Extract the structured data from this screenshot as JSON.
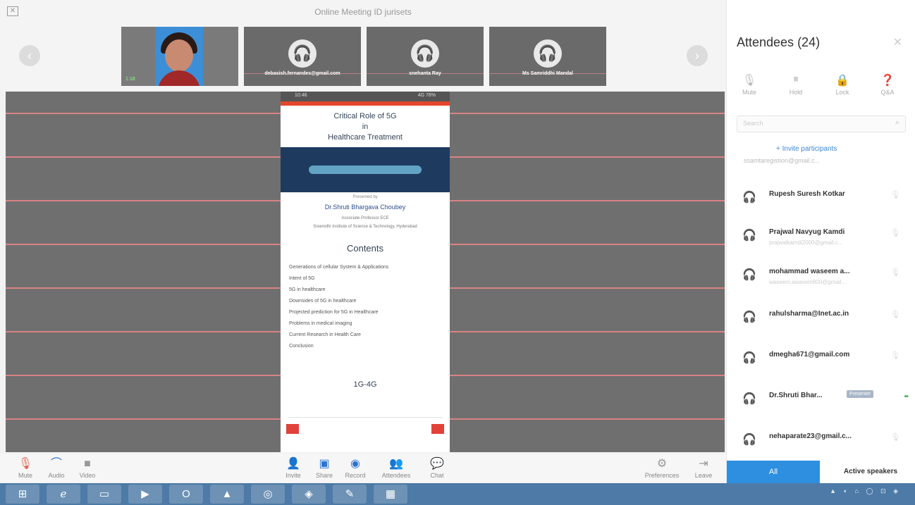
{
  "window": {
    "title": "Online Meeting ID jurisets"
  },
  "video_strip": {
    "tiles": [
      {
        "name": "",
        "badge": "1:18"
      },
      {
        "name": "debasish.fernandes@gmail.com"
      },
      {
        "name": "snehanta Ray"
      },
      {
        "name": "Ms Samriddhi Mandal"
      }
    ]
  },
  "slide": {
    "status_left": "10:46",
    "status_right": "4G 78%",
    "title_line1": "Critical Role of 5G",
    "title_line2": "in",
    "title_line3": "Healthcare Treatment",
    "presented_by": "Presented by",
    "author": "Dr.Shruti Bhargava Choubey",
    "role": "Associate Professor ECE",
    "institute": "Sreenidhi Institute of Science & Technology, Hyderabad",
    "contents_heading": "Contents",
    "contents": [
      "Generations of cellular System & Applications",
      "Intent of 5G",
      "5G in healthcare",
      "Downsides of 5G in healthcare",
      "Projected prediction for 5G in Healthcare",
      "Problems in medical imaging",
      "Current Research in Health Care",
      "Conclusion"
    ],
    "tag": "1G-4G"
  },
  "toolbar": {
    "mute": "Mute",
    "audio": "Audio",
    "video": "Video",
    "invite": "Invite",
    "share": "Share",
    "record": "Record",
    "attendees": "Attendees",
    "chat": "Chat",
    "preferences": "Preferences",
    "leave": "Leave"
  },
  "sidebar": {
    "header": "Attendees (24)",
    "controls": {
      "mute": "Mute",
      "hold": "Hold",
      "lock": "Lock",
      "qa": "Q&A"
    },
    "search_placeholder": "Search",
    "invite": "+ Invite participants",
    "faded_email": "ssamtaregistion@gmail.c...",
    "attendees": [
      {
        "name": "Rupesh Suresh Kotkar",
        "email": ""
      },
      {
        "name": "Prajwal Navyug Kamdi",
        "email": "prajwalkamdi2000@gmail.c..."
      },
      {
        "name": "mohammad waseem a...",
        "email": "waseem.awasem800@gmail..."
      },
      {
        "name": "rahulsharma@Inet.ac.in",
        "email": ""
      },
      {
        "name": "dmegha671@gmail.com",
        "email": ""
      },
      {
        "name": "Dr.Shruti Bhar...",
        "email": "",
        "badge": "Presenter"
      },
      {
        "name": "nehaparate23@gmail.c...",
        "email": ""
      }
    ],
    "tab_all": "All",
    "tab_active": "Active speakers"
  },
  "taskbar": {
    "tray": "▲ ◐ ⌂ ◯ ⊡ ◈"
  },
  "colors": {
    "accent": "#2e8ee0",
    "mute_red": "#e45a4a",
    "share_bg": "#6f6f6f"
  }
}
